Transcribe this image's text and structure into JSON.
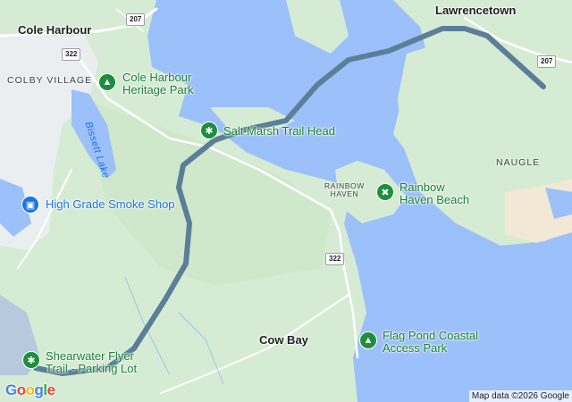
{
  "places": {
    "cole_harbour": "Cole Harbour",
    "lawrencetown": "Lawrencetown",
    "cow_bay": "Cow Bay"
  },
  "areas": {
    "colby_village": "COLBY VILLAGE",
    "naugle": "NAUGLE",
    "rainbow_haven_1": "RAINBOW",
    "rainbow_haven_2": "HAVEN"
  },
  "water": {
    "bissett_lake": "Bissett Lake"
  },
  "pois": {
    "cole_harbour_park_1": "Cole Harbour",
    "cole_harbour_park_2": "Heritage Park",
    "salt_marsh": "Salt Marsh Trail Head",
    "smoke_shop": "High Grade Smoke Shop",
    "rainbow_beach_1": "Rainbow",
    "rainbow_beach_2": "Haven Beach",
    "flag_pond_1": "Flag Pond Coastal",
    "flag_pond_2": "Access Park",
    "shearwater_1": "Shearwater Flyer",
    "shearwater_2": "Trail - Parking Lot"
  },
  "icons": {
    "park": "tree-icon",
    "trail": "hiker-icon",
    "shop": "shopping-bag-icon",
    "beach": "beach-icon"
  },
  "shields": {
    "r207_a": "207",
    "r322_a": "322",
    "r207_b": "207",
    "r322_b": "322"
  },
  "route_color": "#5b7f99",
  "attribution": "Map data ©2026 Google",
  "logo": [
    "G",
    "o",
    "o",
    "g",
    "l",
    "e"
  ]
}
